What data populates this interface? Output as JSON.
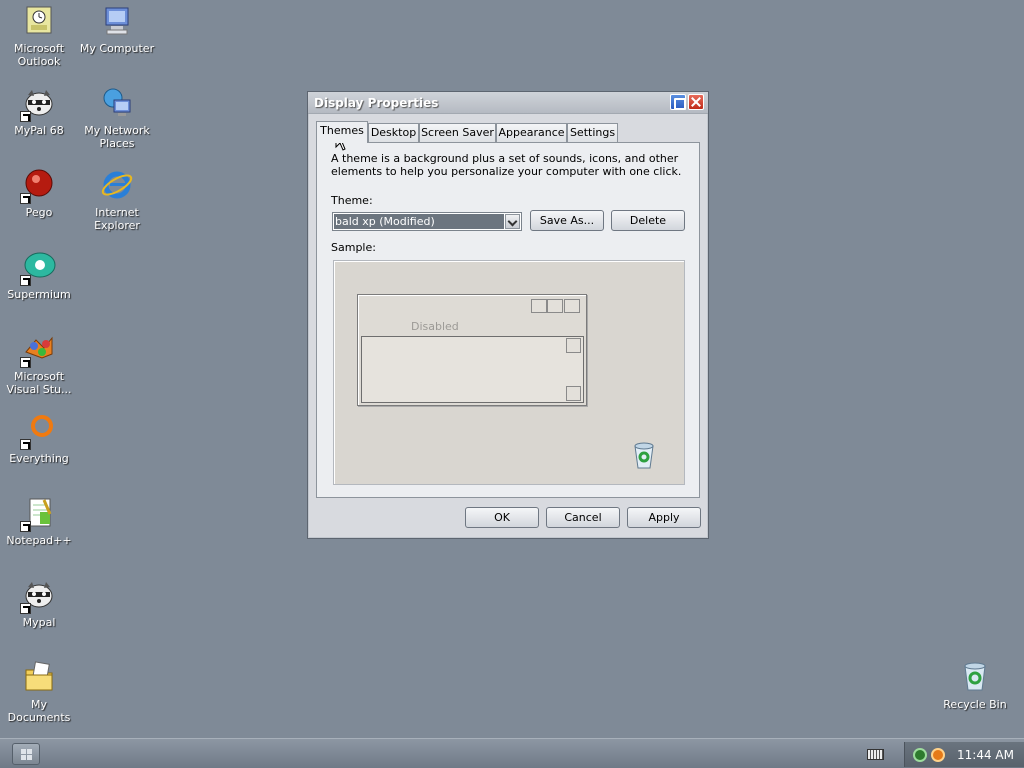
{
  "desktop": {
    "icons": [
      {
        "label": "Microsoft Outlook",
        "icon": "outlook-icon"
      },
      {
        "label": "My Computer",
        "icon": "computer-icon"
      },
      {
        "label": "MyPal 68",
        "icon": "raccoon-icon"
      },
      {
        "label": "My Network Places",
        "icon": "network-icon"
      },
      {
        "label": "Pego",
        "icon": "pego-icon"
      },
      {
        "label": "Internet Explorer",
        "icon": "ie-icon"
      },
      {
        "label": "Supermium",
        "icon": "supermium-icon"
      },
      {
        "label": "Microsoft Visual Stu...",
        "icon": "visual-studio-icon"
      },
      {
        "label": "Everything",
        "icon": "everything-icon"
      },
      {
        "label": "Notepad++",
        "icon": "notepadpp-icon"
      },
      {
        "label": "Mypal",
        "icon": "raccoon-icon"
      },
      {
        "label": "My Documents",
        "icon": "documents-icon"
      },
      {
        "label": "Recycle Bin",
        "icon": "recycle-bin-icon"
      }
    ]
  },
  "window": {
    "title": "Display Properties",
    "tabs": [
      "Themes",
      "Desktop",
      "Screen Saver",
      "Appearance",
      "Settings"
    ],
    "active_tab": "Themes",
    "description": "A theme is a background plus a set of sounds, icons, and other elements to help you personalize your computer with one click.",
    "theme_label": "Theme:",
    "theme_value": "bald xp (Modified)",
    "save_as_label": "Save As...",
    "delete_label": "Delete",
    "sample_label": "Sample:",
    "sample_disabled_text": "Disabled",
    "ok_label": "OK",
    "cancel_label": "Cancel",
    "apply_label": "Apply"
  },
  "taskbar": {
    "clock": "11:44 AM"
  },
  "colors": {
    "desktop_bg": "#7f8a97",
    "window_bg": "#d8dadf",
    "selection": "#6c757f"
  }
}
